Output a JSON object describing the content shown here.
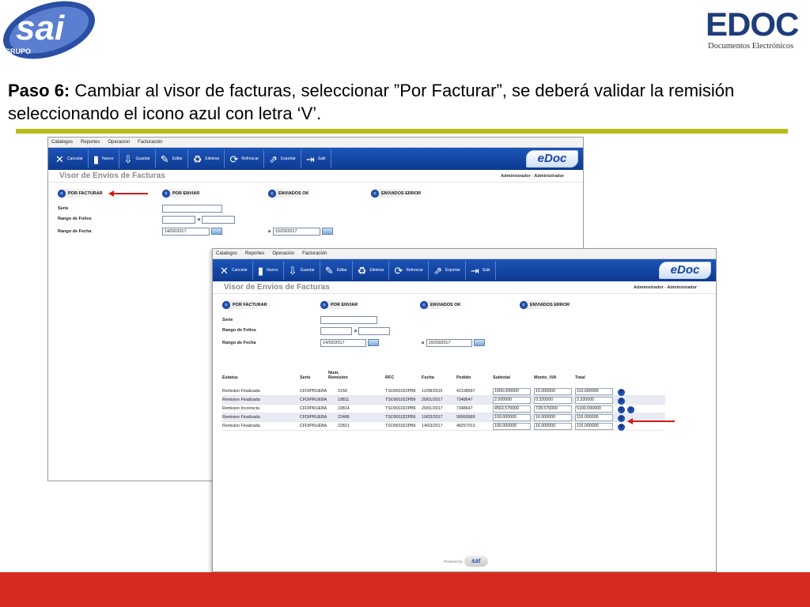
{
  "logos": {
    "left": {
      "text": "sai",
      "sub": "GRUPO"
    },
    "right": {
      "text": "EDOC",
      "sub": "Documentos Electrónicos"
    }
  },
  "heading": {
    "step": "Paso 6:",
    "text": " Cambiar al visor de facturas, seleccionar ”Por Facturar”, se deberá validar la remisión seleccionando el icono azul con letra ‘V’."
  },
  "colors": {
    "rule": "#b6be1a",
    "footer": "#d62a1f",
    "toolbar": "#1c54b8",
    "arrow": "#d21b1b"
  },
  "app": {
    "menu": [
      "Catalogos",
      "Reportes",
      "Operacion",
      "Facturación"
    ],
    "toolbar": [
      {
        "icon": "close-icon",
        "label": "Cancelar"
      },
      {
        "icon": "new-document-icon",
        "label": "Nuevo"
      },
      {
        "icon": "save-icon",
        "label": "Guardar"
      },
      {
        "icon": "edit-icon",
        "label": "Editar"
      },
      {
        "icon": "trash-icon",
        "label": "Eliminar"
      },
      {
        "icon": "refresh-icon",
        "label": "Refrescar"
      },
      {
        "icon": "export-icon",
        "label": "Exportar"
      },
      {
        "icon": "exit-icon",
        "label": "Salir"
      }
    ],
    "brand": "eDoc",
    "title": "Visor de Envios de Facturas",
    "user": "Administrador - Administrador",
    "status_buttons": [
      "POR FACTURAR",
      "POR ENVIAR",
      "ENVIADOS OK",
      "ENVIADOS ERROR"
    ],
    "form": {
      "serie_label": "Serie",
      "folios_label": "Rango de Folios",
      "folios_sep": "a",
      "fecha_label": "Rango de Fecha",
      "fecha_desde": "14/02/2017",
      "fecha_sep": "a",
      "fecha_hasta": "15/03/2017"
    },
    "table": {
      "headers": [
        "Estatus",
        "Serie",
        "Num. Remisión",
        "RFC",
        "Fecha",
        "Pedido",
        "Subtotal",
        "Monto_IVA",
        "Total"
      ],
      "rows": [
        [
          "Remision Finalizada",
          "CFDIPRUEBA",
          "3158",
          "TSO991022PB6",
          "12/08/2015",
          "42198597",
          "1000.000000",
          "16.000000",
          "116.000000"
        ],
        [
          "Remision Finalizada",
          "CFDIPRUEBA",
          "19811",
          "TSO991022PB6",
          "20/01/2017",
          "7348647",
          "2.000000",
          "0.320000",
          "2.320000"
        ],
        [
          "Remision Incorrecta",
          "CFDIPRUEBA",
          "19814",
          "TSO991022PB6",
          "20/01/2017",
          "7348647",
          "4563.570000",
          "728.570000",
          "5100.000000"
        ],
        [
          "Remision Finalizada",
          "CFDIPRUEBA",
          "22486",
          "TSO991022PB6",
          "10/03/2017",
          "99999999",
          "100.000000",
          "16.000000",
          "116.000000"
        ],
        [
          "Remision Finalizada",
          "CFDIPRUEBA",
          "22821",
          "TSO991022PB6",
          "14/03/2017",
          "48257013",
          "100.000000",
          "16.000000",
          "116.000000"
        ]
      ],
      "validate_label": "V"
    },
    "powered": {
      "text": "Powered by",
      "brand": "sat"
    }
  }
}
